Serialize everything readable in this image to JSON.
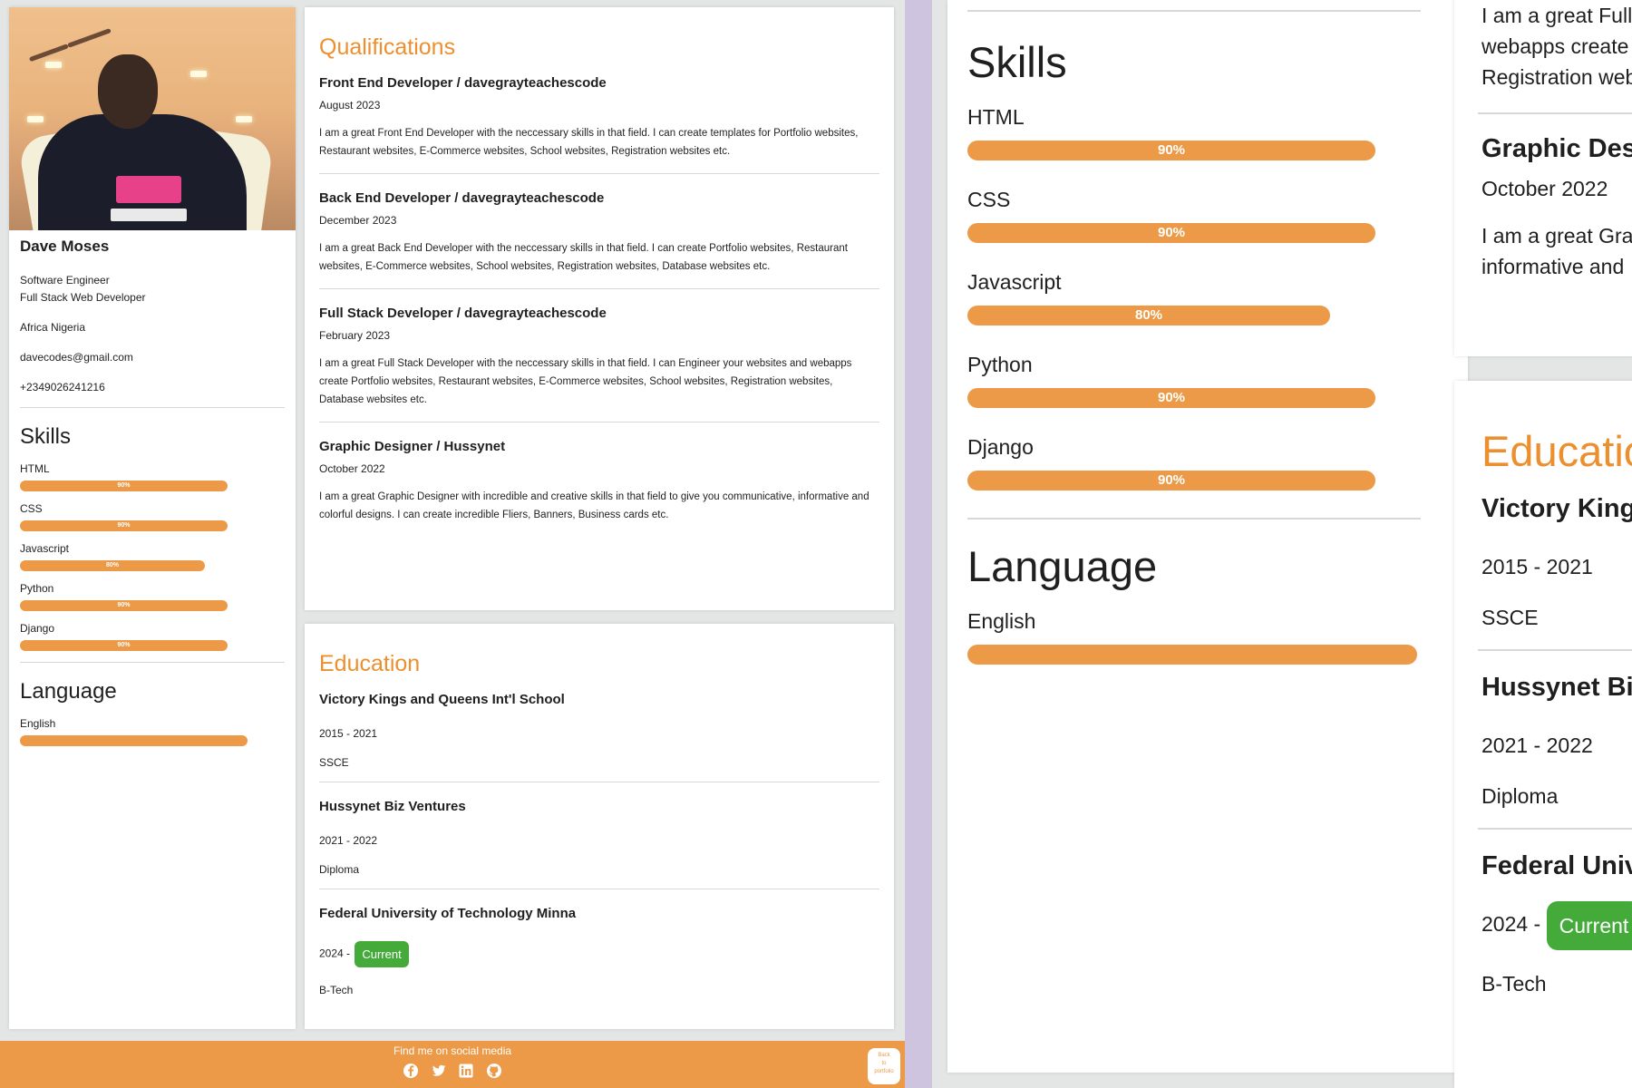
{
  "profile": {
    "name": "Dave Moses",
    "role1": "Software Engineer",
    "role2": "Full Stack Web Developer",
    "location": "Africa Nigeria",
    "email": "davecodes@gmail.com",
    "phone": "+2349026241216"
  },
  "skills_heading": "Skills",
  "skills": [
    {
      "name": "HTML",
      "label": "90%",
      "level": 0.9
    },
    {
      "name": "CSS",
      "label": "90%",
      "level": 0.9
    },
    {
      "name": "Javascript",
      "label": "80%",
      "level": 0.8
    },
    {
      "name": "Python",
      "label": "90%",
      "level": 0.9
    },
    {
      "name": "Django",
      "label": "90%",
      "level": 0.9
    }
  ],
  "language_heading": "Language",
  "languages": [
    {
      "name": "English",
      "level": 1.0
    }
  ],
  "qualifications": {
    "heading": "Qualifications",
    "items": [
      {
        "title": "Front End Developer / davegrayteachescode",
        "date": "August 2023",
        "desc": "I am a great Front End Developer with the neccessary skills in that field. I can create templates for Portfolio websites, Restaurant websites, E-Commerce websites, School websites, Registration websites etc."
      },
      {
        "title": "Back End Developer / davegrayteachescode",
        "date": "December 2023",
        "desc": "I am a great Back End Developer with the neccessary skills in that field. I can create Portfolio websites, Restaurant websites, E-Commerce websites, School websites, Registration websites, Database websites etc."
      },
      {
        "title": "Full Stack Developer / davegrayteachescode",
        "date": "February 2023",
        "desc": "I am a great Full Stack Developer with the neccessary skills in that field. I can Engineer your websites and webapps create Portfolio websites, Restaurant websites, E-Commerce websites, School websites, Registration websites, Database websites etc."
      },
      {
        "title": "Graphic Designer / Hussynet",
        "date": "October 2022",
        "desc": "I am a great Graphic Designer with incredible and creative skills in that field to give you communicative, informative and colorful designs. I can create incredible Fliers, Banners, Business cards etc."
      }
    ]
  },
  "education": {
    "heading": "Education",
    "items": [
      {
        "school": "Victory Kings and Queens Int'l School",
        "years": "2015 - 2021",
        "cert": "SSCE"
      },
      {
        "school": "Hussynet Biz Ventures",
        "years": "2021 - 2022",
        "cert": "Diploma"
      },
      {
        "school": "Federal University of Technology Minna",
        "years": "2024 - ",
        "badge": "Current",
        "cert": "B-Tech"
      }
    ]
  },
  "footer": {
    "text": "Find me on social media",
    "icons": [
      "facebook-icon",
      "twitter-icon",
      "linkedin-icon",
      "github-icon"
    ],
    "back_label_1": "Back",
    "back_label_2": "to",
    "back_label_3": "portfolio"
  },
  "zoom": {
    "main_line1": "I am a great Full",
    "main_line2": "webapps create",
    "main_line3": "Registration web",
    "main_title": "Graphic Desig",
    "main_date": "October 2022",
    "main_desc1": "I am a great Grap",
    "main_desc2": "informative and",
    "edu_heading": "Educatio",
    "edu1": "Victory Kings",
    "edu2": "Hussynet Biz",
    "edu3": "Federal Unive"
  },
  "colors": {
    "accent": "#ec9a47",
    "heading": "#ec8f2f",
    "badge": "#44ab3b",
    "divider": "#cfc4df"
  }
}
